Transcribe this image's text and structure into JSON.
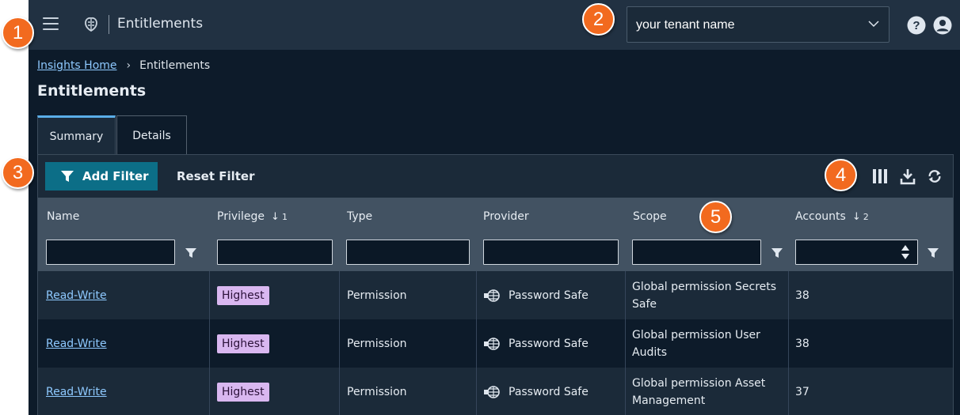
{
  "header": {
    "app_title": "Entitlements",
    "tenant_select": {
      "value": "your tenant name"
    }
  },
  "breadcrumb": {
    "home": "Insights Home",
    "current": "Entitlements"
  },
  "page_title": "Entitlements",
  "tabs": [
    {
      "label": "Summary",
      "active": true
    },
    {
      "label": "Details",
      "active": false
    }
  ],
  "toolbar": {
    "add_filter_label": "Add Filter",
    "reset_filter_label": "Reset Filter"
  },
  "table": {
    "columns": [
      {
        "label": "Name"
      },
      {
        "label": "Privilege",
        "sort_arrow": "↓",
        "sort_order": "1"
      },
      {
        "label": "Type"
      },
      {
        "label": "Provider"
      },
      {
        "label": "Scope"
      },
      {
        "label": "Accounts",
        "sort_arrow": "↓",
        "sort_order": "2"
      }
    ],
    "rows": [
      {
        "name": "Read-Write",
        "privilege": "Highest",
        "type": "Permission",
        "provider": "Password Safe",
        "scope": "Global permission Secrets Safe",
        "accounts": "38"
      },
      {
        "name": "Read-Write",
        "privilege": "Highest",
        "type": "Permission",
        "provider": "Password Safe",
        "scope": "Global permission User Audits",
        "accounts": "38"
      },
      {
        "name": "Read-Write",
        "privilege": "Highest",
        "type": "Permission",
        "provider": "Password Safe",
        "scope": "Global permission Asset Management",
        "accounts": "37"
      }
    ]
  },
  "callouts": [
    "1",
    "2",
    "3",
    "4",
    "5"
  ],
  "colors": {
    "accent": "#0c6e87",
    "callout": "#f26a1f",
    "badge": "#d9b7f0",
    "link": "#8ec9ff"
  }
}
